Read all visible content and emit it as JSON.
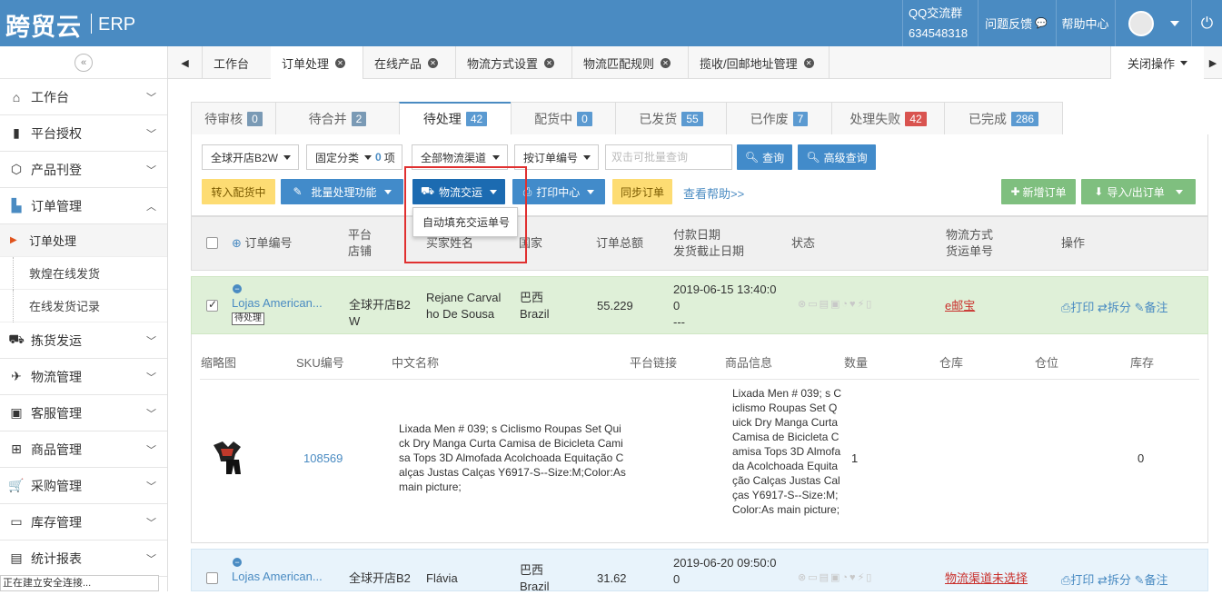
{
  "header": {
    "logo": "跨贸云",
    "logo_suffix": "ERP",
    "qq_label": "QQ交流群",
    "qq_number": "634548318",
    "feedback": "问题反馈",
    "help": "帮助中心"
  },
  "sidebar": {
    "collapse_icon": "«",
    "items": [
      {
        "label": "工作台",
        "icon": "home-icon"
      },
      {
        "label": "平台授权",
        "icon": "bookmark-icon"
      },
      {
        "label": "产品刊登",
        "icon": "cube-icon"
      },
      {
        "label": "订单管理",
        "icon": "file-icon"
      }
    ],
    "subitems": [
      "订单处理",
      "敦煌在线发货",
      "在线发货记录"
    ],
    "items2": [
      {
        "label": "拣货发运",
        "icon": "truck-icon"
      },
      {
        "label": "物流管理",
        "icon": "plane-icon"
      },
      {
        "label": "客服管理",
        "icon": "briefcase-icon"
      },
      {
        "label": "商品管理",
        "icon": "gift-icon"
      },
      {
        "label": "采购管理",
        "icon": "cart-icon"
      },
      {
        "label": "库存管理",
        "icon": "inbox-icon"
      },
      {
        "label": "统计报表",
        "icon": "report-icon"
      }
    ],
    "connection_status": "正在建立安全连接..."
  },
  "page_tabs": [
    "工作台",
    "订单处理",
    "在线产品",
    "物流方式设置",
    "物流匹配规则",
    "揽收/回邮地址管理"
  ],
  "close_ops": "关闭操作",
  "status_tabs": [
    {
      "label": "待审核",
      "count": "0"
    },
    {
      "label": "待合并",
      "count": "2"
    },
    {
      "label": "待处理",
      "count": "42"
    },
    {
      "label": "配货中",
      "count": "0"
    },
    {
      "label": "已发货",
      "count": "55"
    },
    {
      "label": "已作废",
      "count": "7"
    },
    {
      "label": "处理失败",
      "count": "42"
    },
    {
      "label": "已完成",
      "count": "286"
    }
  ],
  "filters": {
    "store": "全球开店B2W",
    "category": "固定分类",
    "category_count": "0",
    "category_unit": "项",
    "channel": "全部物流渠道",
    "order_by": "按订单编号",
    "search_placeholder": "双击可批量查询",
    "query": "查询",
    "advanced": "高级查询"
  },
  "actions": {
    "to_picking": "转入配货中",
    "batch": "批量处理功能",
    "logistics": "物流交运",
    "print": "打印中心",
    "sync": "同步订单",
    "help": "查看帮助>>",
    "new_order": "新增订单",
    "import_export": "导入/出订单",
    "dropdown_item": "自动填充交运单号"
  },
  "table_head": {
    "order_no": "订单编号",
    "platform": "平台",
    "store": "店铺",
    "buyer": "买家姓名",
    "country": "国家",
    "total": "订单总额",
    "pay_date": "付款日期",
    "ship_deadline": "发货截止日期",
    "status": "状态",
    "logistics": "物流方式",
    "tracking": "货运单号",
    "operation": "操作"
  },
  "orders": [
    {
      "order_no": "Lojas American...",
      "tag": "待处理",
      "store": "全球开店B2W",
      "buyer": "Rejane Carvalho De Sousa",
      "country_cn": "巴西",
      "country_en": "Brazil",
      "total": "55.229",
      "pay_date": "2019-06-15 13:40:00",
      "deadline": "---",
      "logistics": "e邮宝",
      "print": "打印",
      "split": "拆分",
      "note": "备注"
    },
    {
      "order_no": "Lojas American...",
      "store": "全球开店B2",
      "buyer": "Flávia",
      "country_cn": "巴西",
      "country_en": "Brazil",
      "total": "31.62",
      "pay_date": "2019-06-20 09:50:00",
      "logistics": "物流渠道未选择",
      "print": "打印",
      "split": "拆分",
      "note": "备注"
    }
  ],
  "product_head": {
    "thumb": "缩略图",
    "sku": "SKU编号",
    "cn_name": "中文名称",
    "link": "平台链接",
    "info": "商品信息",
    "qty": "数量",
    "warehouse": "仓库",
    "location": "仓位",
    "stock": "库存"
  },
  "product": {
    "sku": "108569",
    "cn_name": "Lixada Men # 039; s Ciclismo Roupas Set Quick Dry Manga Curta Camisa de Bicicleta Camisa Tops 3D Almofada Acolchoada Equitação Calças Justas Calças Y6917-S--Size:M;Color:As main picture;",
    "info": "Lixada Men # 039; s Ciclismo Roupas Set Quick Dry Manga Curta Camisa de Bicicleta Camisa Tops 3D Almofada Acolchoada Equitação Calças Justas Calças Y6917-S--Size:M;Color:As main picture;",
    "qty": "1",
    "stock": "0"
  }
}
